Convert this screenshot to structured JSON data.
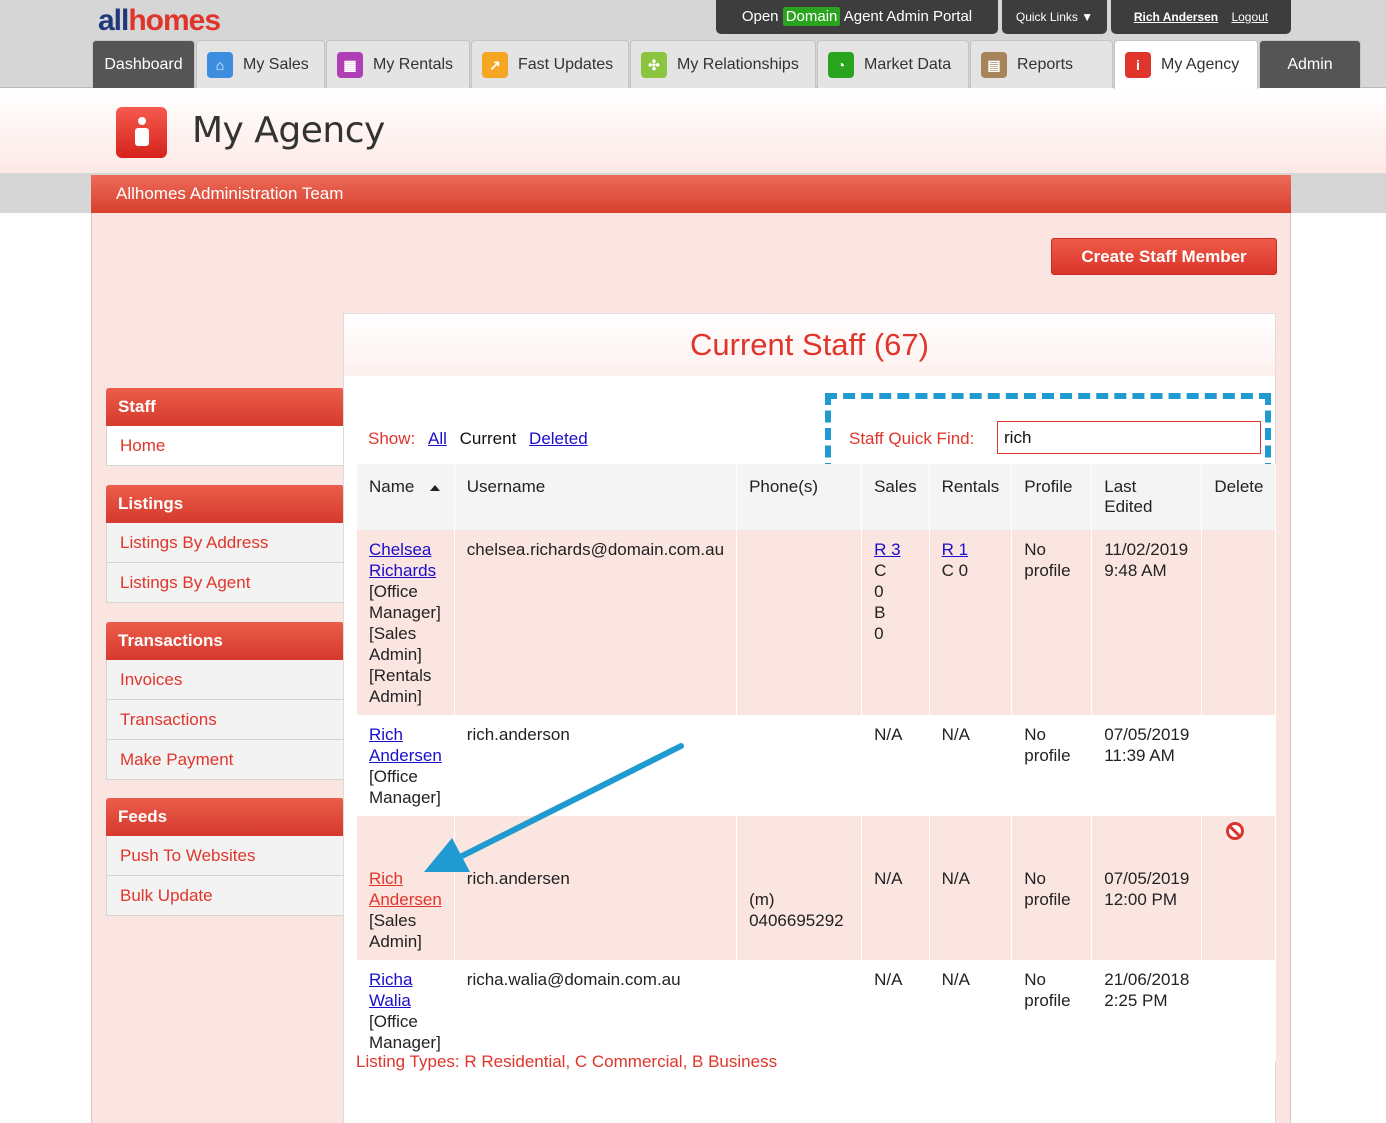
{
  "logo": {
    "part1": "all",
    "part2": "homes"
  },
  "topbar": {
    "portal_open": "Open",
    "portal_domain": "Domain",
    "portal_rest": "Agent Admin Portal",
    "quick_links": "Quick Links ▼",
    "user_name": "Rich Andersen",
    "logout": "Logout"
  },
  "tabs": [
    {
      "label": "Dashboard"
    },
    {
      "label": "My Sales",
      "icon": "house-icon",
      "color": "#3d8de0"
    },
    {
      "label": "My Rentals",
      "icon": "building-icon",
      "color": "#b03fb5"
    },
    {
      "label": "Fast Updates",
      "icon": "lightning-icon",
      "color": "#f5a623"
    },
    {
      "label": "My Relationships",
      "icon": "network-icon",
      "color": "#8bc43f"
    },
    {
      "label": "Market Data",
      "icon": "pie-chart-icon",
      "color": "#2aa31e"
    },
    {
      "label": "Reports",
      "icon": "clipboard-icon",
      "color": "#a8845a"
    },
    {
      "label": "My Agency",
      "icon": "agency-icon",
      "color": "#e0352b"
    },
    {
      "label": "Admin"
    }
  ],
  "header": {
    "page_title": "My Agency",
    "team_name": "Allhomes Administration Team"
  },
  "actions": {
    "create_staff": "Create Staff Member"
  },
  "sidebar": [
    {
      "heading": "Staff",
      "items": [
        "Home"
      ]
    },
    {
      "heading": "Listings",
      "items": [
        "Listings By Address",
        "Listings By Agent"
      ]
    },
    {
      "heading": "Transactions",
      "items": [
        "Invoices",
        "Transactions",
        "Make Payment"
      ]
    },
    {
      "heading": "Feeds",
      "items": [
        "Push To Websites",
        "Bulk Update"
      ]
    }
  ],
  "content": {
    "title": "Current Staff (67)",
    "show_label": "Show:",
    "show_all": "All",
    "show_current": "Current",
    "show_deleted": "Deleted",
    "quick_find_label": "Staff Quick Find:",
    "quick_find_value": "rich",
    "legend": "Listing Types: R Residential, C Commercial, B Business"
  },
  "table": {
    "headers": [
      "Name",
      "Username",
      "Phone(s)",
      "Sales",
      "Rentals",
      "Profile",
      "Last Edited",
      "Delete"
    ],
    "rows": [
      {
        "first": "Chelsea",
        "last": "Richards",
        "roles": "[Office Manager] [Sales Admin] [Rentals Admin]",
        "username": "chelsea.richards@domain.com.au",
        "phone": "",
        "sales_link": "R 3",
        "sales_rest": "C 0 B 0",
        "rentals_link": "R 1",
        "rentals_rest": "C 0",
        "profile": "No profile",
        "edited_date": "11/02/2019",
        "edited_time": "9:48 AM"
      },
      {
        "first": "Rich",
        "last": "Andersen",
        "roles": "[Office Manager]",
        "username": "rich.anderson",
        "phone": "",
        "sales": "N/A",
        "rentals": "N/A",
        "profile": "No profile",
        "edited_date": "07/05/2019",
        "edited_time": "11:39 AM"
      },
      {
        "first": "Rich",
        "last": "Andersen",
        "roles": "[Sales Admin]",
        "username": "rich.andersen",
        "phone": "(m) 0406695292",
        "sales": "N/A",
        "rentals": "N/A",
        "profile": "No profile",
        "edited_date": "07/05/2019",
        "edited_time": "12:00 PM"
      },
      {
        "first": "Richa",
        "last": "Walia",
        "roles": "[Office Manager]",
        "username": "richa.walia@domain.com.au",
        "phone": "",
        "sales": "N/A",
        "rentals": "N/A",
        "profile": "No profile",
        "edited_date": "21/06/2018",
        "edited_time": "2:25 PM"
      }
    ]
  },
  "colors": {
    "accent": "#e0352b",
    "highlight": "#1f9bd1",
    "link": "#1a0dcc"
  }
}
